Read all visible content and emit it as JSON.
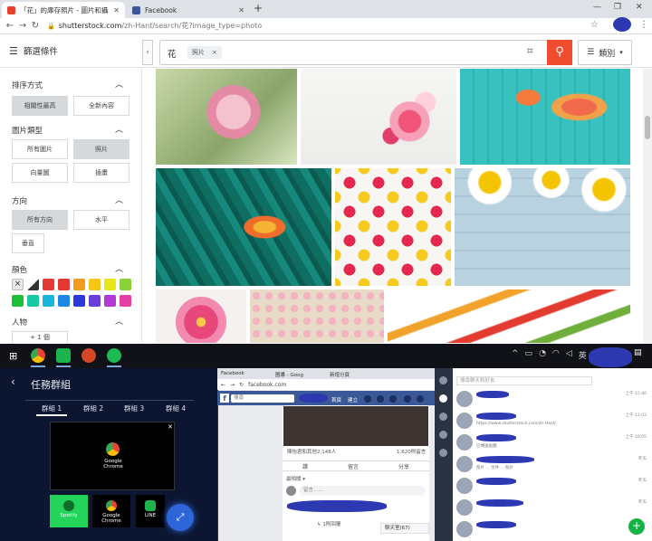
{
  "browser": {
    "tabs": [
      {
        "title": "「花」的庫存照片 - 圖片和攝影",
        "active": true
      },
      {
        "title": "Facebook",
        "active": false
      }
    ],
    "url_host": "shutterstock.com",
    "url_path": "/zh-Hant/search/花?image_type=photo"
  },
  "header": {
    "filter_label": "篩選條件",
    "search_term": "花",
    "chip_label": "照片",
    "chip_close": "×",
    "category_label": "類別"
  },
  "sidebar": {
    "sort": {
      "title": "排序方式",
      "options": [
        "相關性最高",
        "全新內容"
      ],
      "selected": 0
    },
    "image_type": {
      "title": "圖片類型",
      "options": [
        "所有圖片",
        "照片",
        "向量圖",
        "插畫"
      ],
      "selected": 1
    },
    "orientation": {
      "title": "方向",
      "options": [
        "所有方向",
        "水平",
        "垂直"
      ],
      "selected": 0
    },
    "color": {
      "title": "顏色",
      "swatches": [
        "#e8e8e8",
        "#555555",
        "#e53935",
        "#e53935",
        "#f29b1e",
        "#f6c515",
        "#e6e619",
        "#8bd23a",
        "#1fbf3a",
        "#19c8a0",
        "#18b6d8",
        "#1e88e5",
        "#2c39d8",
        "#6a3fd9",
        "#b438d4",
        "#e53ea5"
      ]
    },
    "people": {
      "title": "人物",
      "add_label": "+ 1 個"
    }
  },
  "taskbar": {
    "apps": [
      "Chrome",
      "LINE",
      "PowerPoint",
      "Spotify"
    ]
  },
  "task_panel": {
    "title": "任務群組",
    "groups": [
      "群組 1",
      "群組 2",
      "群組 3",
      "群組 4"
    ],
    "card_app": "Google Chrome",
    "tiles": [
      "Spotify",
      "Google Chrome",
      "LINE"
    ]
  },
  "facebook_window": {
    "tabs": [
      "Facebook",
      "圖書 - Goog",
      "新增分頁"
    ],
    "url": "facebook.com",
    "search_placeholder": "搜尋",
    "nav": [
      "首頁",
      "建立"
    ],
    "reactions": "陳怡君和其他2,148人",
    "comments": "1,620則留言",
    "actions": [
      "讚",
      "留言",
      "分享"
    ],
    "relevance": "最相關 ▾",
    "comment_placeholder": "留言……",
    "reply": "↳ 1則回覆",
    "chat": "聊天室(67)"
  },
  "line_window": {
    "search_placeholder": "搜尋聊天和好友",
    "chats": [
      {
        "time": "上午 11:46",
        "msg": ""
      },
      {
        "time": "上午 11:02",
        "msg": "https://www.shutterstock.com/zh-Hant/"
      },
      {
        "time": "上午 10:05",
        "msg": "已傳送貼圖"
      },
      {
        "time": "昨天",
        "msg": "照片 ... 文件 ... 照片"
      },
      {
        "time": "昨天",
        "msg": ""
      },
      {
        "time": "昨天",
        "msg": ""
      },
      {
        "time": "星期一",
        "msg": ""
      }
    ]
  }
}
